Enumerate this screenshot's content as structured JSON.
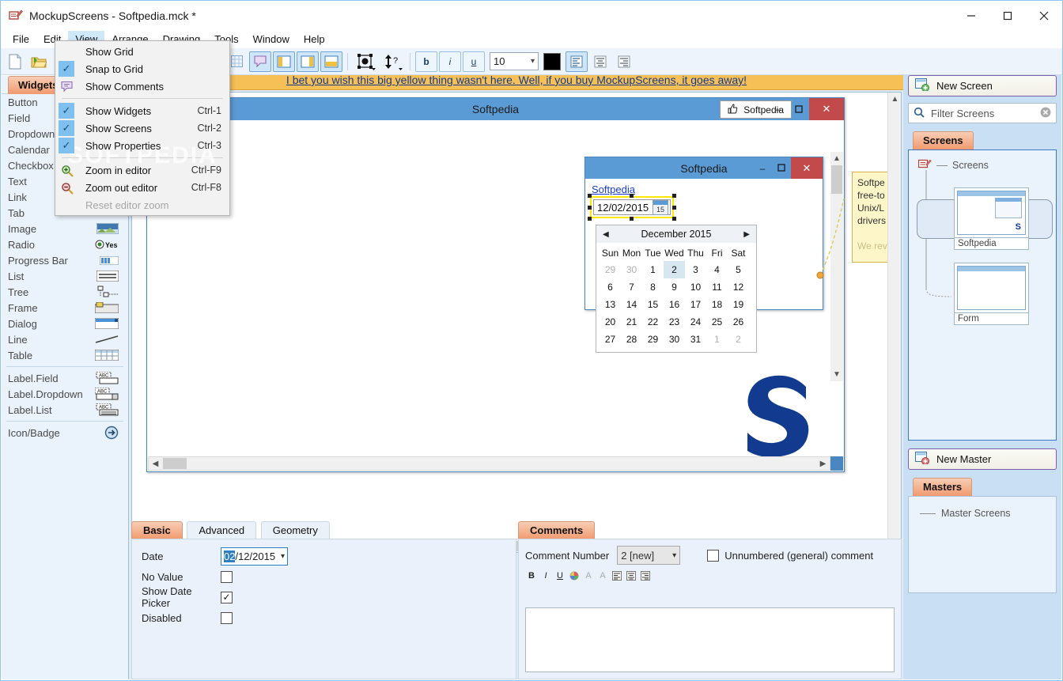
{
  "window": {
    "title": "MockupScreens - Softpedia.mck *",
    "icon": "mockupscreens-app-icon",
    "controls": {
      "minimize": "—",
      "maximize": "☐",
      "close": "✕"
    }
  },
  "menubar": {
    "items": [
      {
        "label": "File"
      },
      {
        "label": "Edit"
      },
      {
        "label": "View",
        "active": true
      },
      {
        "label": "Arrange"
      },
      {
        "label": "Drawing"
      },
      {
        "label": "Tools"
      },
      {
        "label": "Window"
      },
      {
        "label": "Help"
      }
    ]
  },
  "view_menu": {
    "watermark": "SOFTPEDIA",
    "items": [
      {
        "label": "Show Grid",
        "shortcut": "",
        "checked": false,
        "icon": "",
        "disabled": false
      },
      {
        "label": "Snap to Grid",
        "shortcut": "",
        "checked": true,
        "icon": "",
        "disabled": false
      },
      {
        "label": "Show Comments",
        "shortcut": "",
        "checked": false,
        "icon": "comment-bubble-icon",
        "disabled": false
      },
      {
        "separator": true
      },
      {
        "label": "Show Widgets",
        "shortcut": "Ctrl-1",
        "checked": true,
        "icon": "",
        "disabled": false
      },
      {
        "label": "Show Screens",
        "shortcut": "Ctrl-2",
        "checked": true,
        "icon": "",
        "disabled": false
      },
      {
        "label": "Show Properties",
        "shortcut": "Ctrl-3",
        "checked": true,
        "icon": "",
        "disabled": false
      },
      {
        "separator": true
      },
      {
        "label": "Zoom in editor",
        "shortcut": "Ctrl-F9",
        "checked": false,
        "icon": "zoom-in-icon",
        "disabled": false
      },
      {
        "label": "Zoom out editor",
        "shortcut": "Ctrl-F8",
        "checked": false,
        "icon": "zoom-out-icon",
        "disabled": false
      },
      {
        "label": "Reset editor zoom",
        "shortcut": "",
        "checked": false,
        "icon": "",
        "disabled": true
      }
    ]
  },
  "toolbar": {
    "new_label": "new-file-icon",
    "open_label": "open-folder-icon",
    "present_label": "presentation-icon",
    "capture_label": "camera-icon",
    "theme_value": "Windows8",
    "grid_icon": "grid-icon",
    "comments_icon": "comment-bubble-icon",
    "show_widgets_icon": "panel-left-icon",
    "show_screens_icon": "panel-right-icon",
    "show_properties_icon": "panel-bottom-icon",
    "resize_icon": "resize-icon",
    "order_icon": "z-order-icon",
    "bold_label": "b",
    "italic_label": "i",
    "underline_label": "u",
    "font_size": "10",
    "color_swatch": "#000000",
    "align_left_icon": "align-left-icon",
    "align_center_icon": "align-center-icon",
    "align_right_icon": "align-right-icon"
  },
  "widgets_panel": {
    "tab_label": "Widgets",
    "groups": [
      {
        "items": [
          {
            "label": "Button",
            "icon": "button-widget-icon"
          },
          {
            "label": "Field",
            "icon": "field-widget-icon"
          },
          {
            "label": "Dropdown",
            "icon": "dropdown-widget-icon"
          },
          {
            "label": "Calendar",
            "icon": "calendar-widget-icon"
          },
          {
            "label": "Checkbox",
            "icon": "checkbox-widget-icon"
          },
          {
            "label": "Text",
            "icon": "text-widget-icon"
          },
          {
            "label": "Link",
            "icon": "link-widget-icon"
          },
          {
            "label": "Tab",
            "icon": "tab-widget-icon"
          },
          {
            "label": "Image",
            "icon": "image-widget-icon"
          },
          {
            "label": "Radio",
            "icon": "radio-widget-icon"
          },
          {
            "label": "Progress Bar",
            "icon": "progressbar-widget-icon"
          },
          {
            "label": "List",
            "icon": "list-widget-icon"
          },
          {
            "label": "Tree",
            "icon": "tree-widget-icon"
          },
          {
            "label": "Frame",
            "icon": "frame-widget-icon"
          },
          {
            "label": "Dialog",
            "icon": "dialog-widget-icon"
          },
          {
            "label": "Line",
            "icon": "line-widget-icon"
          },
          {
            "label": "Table",
            "icon": "table-widget-icon"
          }
        ]
      },
      {
        "items": [
          {
            "label": "Label.Field",
            "icon": "label-field-widget-icon"
          },
          {
            "label": "Label.Dropdown",
            "icon": "label-dropdown-widget-icon"
          },
          {
            "label": "Label.List",
            "icon": "label-list-widget-icon"
          }
        ]
      },
      {
        "items": [
          {
            "label": "Icon/Badge",
            "icon": "icon-badge-widget-icon"
          }
        ]
      }
    ]
  },
  "banner": {
    "text": "I bet you wish this big yellow thing wasn't here. Well, if you buy MockupScreens, it goes away!"
  },
  "canvas": {
    "outer_window": {
      "title": "Softpedia",
      "like_button": "Softpedia",
      "like_icon": "thumbs-up-icon",
      "minimize": "–",
      "maximize": "☐",
      "close": "✕",
      "logo": "softpedia-s-logo"
    },
    "inner_window": {
      "title": "Softpedia",
      "minimize": "–",
      "maximize": "☐",
      "close": "✕",
      "link_text": "Softpedia",
      "date_value": "12/02/2015",
      "date_picker_icon": "calendar-picker-icon",
      "date_picker_day": "15"
    },
    "calendar": {
      "prev": "◀",
      "next": "▶",
      "month_label": "December 2015",
      "weekdays": [
        "Sun",
        "Mon",
        "Tue",
        "Wed",
        "Thu",
        "Fri",
        "Sat"
      ],
      "weeks": [
        [
          {
            "d": "29",
            "o": true
          },
          {
            "d": "30",
            "o": true
          },
          {
            "d": "1"
          },
          {
            "d": "2",
            "sel": true
          },
          {
            "d": "3"
          },
          {
            "d": "4"
          },
          {
            "d": "5"
          }
        ],
        [
          {
            "d": "6"
          },
          {
            "d": "7"
          },
          {
            "d": "8"
          },
          {
            "d": "9"
          },
          {
            "d": "10"
          },
          {
            "d": "11"
          },
          {
            "d": "12"
          }
        ],
        [
          {
            "d": "13"
          },
          {
            "d": "14"
          },
          {
            "d": "15"
          },
          {
            "d": "16"
          },
          {
            "d": "17"
          },
          {
            "d": "18"
          },
          {
            "d": "19"
          }
        ],
        [
          {
            "d": "20"
          },
          {
            "d": "21"
          },
          {
            "d": "22"
          },
          {
            "d": "23"
          },
          {
            "d": "24"
          },
          {
            "d": "25"
          },
          {
            "d": "26"
          }
        ],
        [
          {
            "d": "27"
          },
          {
            "d": "28"
          },
          {
            "d": "29"
          },
          {
            "d": "30"
          },
          {
            "d": "31"
          },
          {
            "d": "1",
            "o": true
          },
          {
            "d": "2",
            "o": true
          }
        ]
      ]
    },
    "sticky_note": {
      "lines": [
        "Softpe",
        "free-to",
        "Unix/L",
        "drivers"
      ],
      "faded": "We rev"
    }
  },
  "properties": {
    "tabs": [
      {
        "label": "Basic",
        "selected": true
      },
      {
        "label": "Advanced",
        "selected": false
      },
      {
        "label": "Geometry",
        "selected": false
      }
    ],
    "rows": [
      {
        "label": "Date",
        "type": "date",
        "value_hl": "02",
        "value_rest": "/12/2015"
      },
      {
        "label": "No Value",
        "type": "checkbox",
        "checked": false
      },
      {
        "label": "Show Date Picker",
        "type": "checkbox",
        "checked": true
      },
      {
        "label": "Disabled",
        "type": "checkbox",
        "checked": false
      }
    ]
  },
  "comments": {
    "tab_label": "Comments",
    "number_label": "Comment Number",
    "number_value": "2 [new]",
    "unnumbered_label": "Unnumbered (general) comment",
    "unnumbered_checked": false,
    "toolbar": [
      {
        "label": "B",
        "name": "bold-button",
        "dim": false
      },
      {
        "label": "I",
        "name": "italic-button",
        "dim": false
      },
      {
        "label": "U",
        "name": "underline-button",
        "dim": false
      },
      {
        "label": "●",
        "name": "text-color-button",
        "dim": false
      },
      {
        "label": "A",
        "name": "grow-font-button",
        "dim": true
      },
      {
        "label": "A",
        "name": "shrink-font-button",
        "dim": true
      },
      {
        "label": "≡",
        "name": "align-left-button",
        "dim": false
      },
      {
        "label": "≡",
        "name": "align-center-button",
        "dim": false
      },
      {
        "label": "≡",
        "name": "align-right-button",
        "dim": false
      }
    ],
    "body_text": ""
  },
  "right_panel": {
    "new_screen_label": "New Screen",
    "new_screen_icon": "new-screen-icon",
    "filter_placeholder": "Filter Screens",
    "filter_value": "",
    "search_icon": "search-icon",
    "clear_icon": "clear-icon",
    "screens_tab": "Screens",
    "tree_root": "Screens",
    "tree_root_icon": "screens-root-icon",
    "screens": [
      {
        "name": "Softpedia",
        "selected": true
      },
      {
        "name": "Form",
        "selected": false
      }
    ],
    "new_master_label": "New Master",
    "new_master_icon": "new-master-icon",
    "masters_tab": "Masters",
    "masters_root": "Master Screens"
  },
  "colors": {
    "accent_blue": "#5b9bd5",
    "banner_yellow": "#f7c056",
    "tab_orange": "#f09a6e",
    "selection_yellow": "#ffe800",
    "close_red": "#c24a4a",
    "panel_blue": "#c9dff3"
  }
}
